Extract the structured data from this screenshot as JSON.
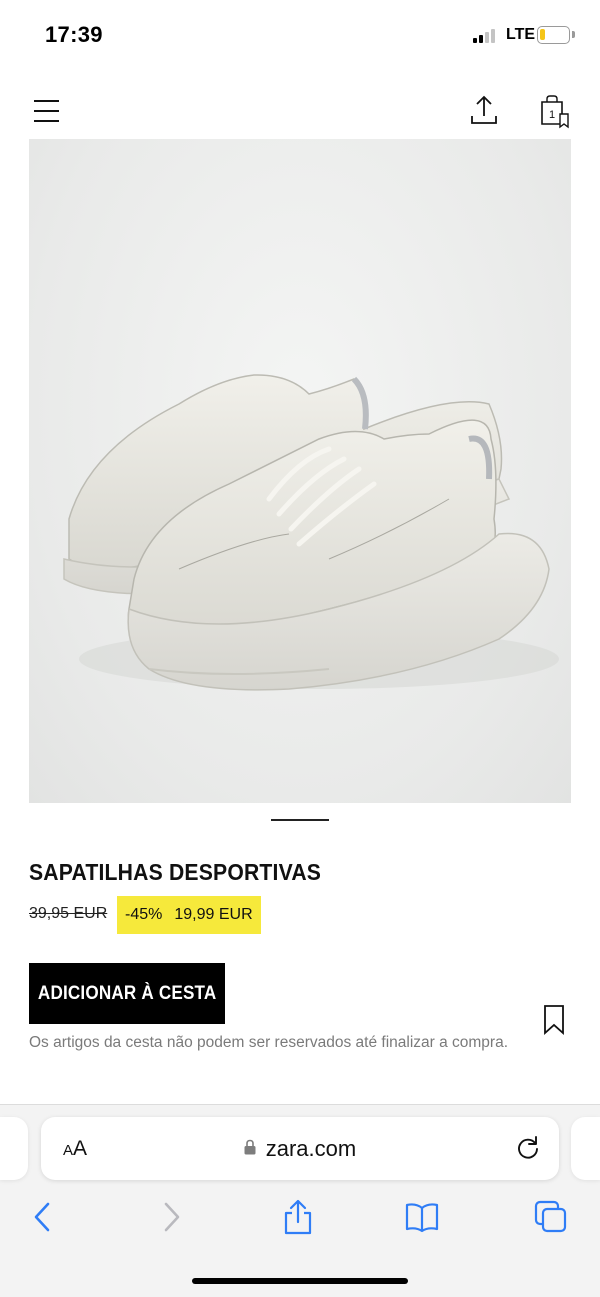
{
  "status_bar": {
    "time": "17:39",
    "network": "LTE",
    "battery_level": 0.2,
    "battery_color": "#f5c518",
    "signal_bars_active": 2
  },
  "header": {
    "menu_icon": "hamburger-icon",
    "share_icon": "share-icon",
    "bag_icon": "shopping-bag-icon",
    "bag_count": "1"
  },
  "product": {
    "image_alt": "white chunky sneakers",
    "title": "SAPATILHAS DESPORTIVAS",
    "old_price": "39,95 EUR",
    "discount": "-45%",
    "price": "19,99 EUR",
    "badge_color": "#f6e93b",
    "add_to_cart_label": "ADICIONAR À CESTA",
    "disclaimer": "Os artigos da cesta não podem ser reservados até finalizar a compra.",
    "bookmark_icon": "bookmark-icon"
  },
  "browser": {
    "text_size_label_big": "A",
    "text_size_label_small": "A",
    "url": "zara.com",
    "lock_icon": "lock-icon",
    "reload_icon": "reload-icon",
    "toolbar": {
      "back_icon": "chevron-left-icon",
      "forward_icon": "chevron-right-icon",
      "share_icon": "share-icon",
      "bookmarks_icon": "book-icon",
      "tabs_icon": "tabs-icon"
    },
    "accent_color": "#2f7df6"
  }
}
